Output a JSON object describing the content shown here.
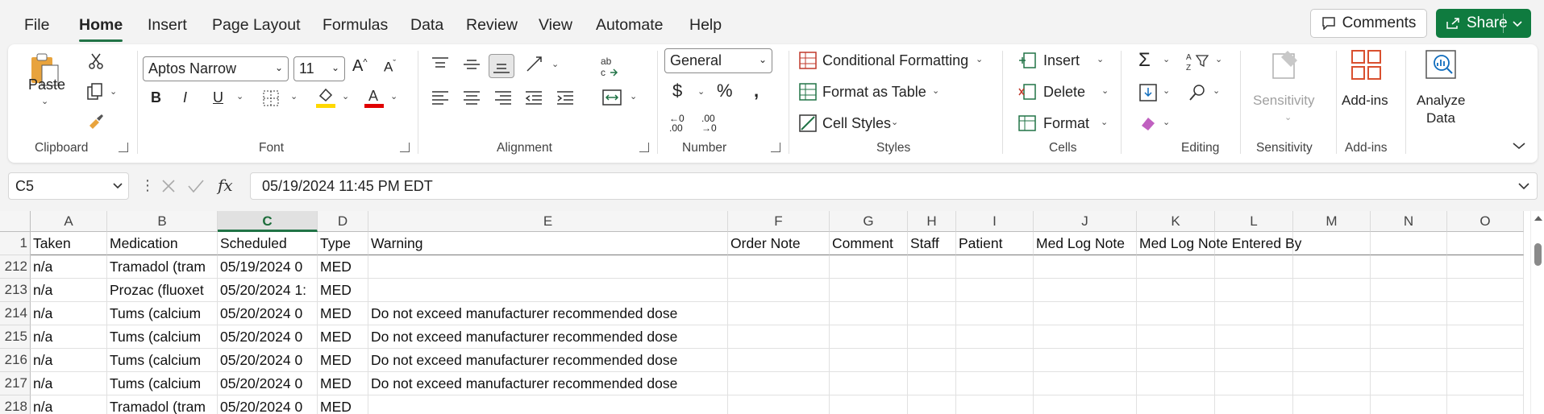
{
  "menu": {
    "tabs": [
      "File",
      "Home",
      "Insert",
      "Page Layout",
      "Formulas",
      "Data",
      "Review",
      "View",
      "Automate",
      "Help"
    ],
    "active_tab": "Home",
    "comments_label": "Comments",
    "share_label": "Share"
  },
  "ribbon": {
    "clipboard": {
      "paste_label": "Paste",
      "group_label": "Clipboard"
    },
    "font": {
      "font_name": "Aptos Narrow",
      "font_size": "11",
      "group_label": "Font",
      "fill_color": "#ffd800",
      "font_color": "#e00000"
    },
    "alignment": {
      "group_label": "Alignment"
    },
    "number": {
      "format": "General",
      "group_label": "Number"
    },
    "styles": {
      "conditional_formatting": "Conditional Formatting",
      "format_as_table": "Format as Table",
      "cell_styles": "Cell Styles",
      "group_label": "Styles"
    },
    "cells": {
      "insert": "Insert",
      "delete": "Delete",
      "format": "Format",
      "group_label": "Cells"
    },
    "editing": {
      "group_label": "Editing"
    },
    "sensitivity": {
      "label": "Sensitivity",
      "group_label": "Sensitivity"
    },
    "addins": {
      "label": "Add-ins",
      "group_label": "Add-ins"
    },
    "analyze": {
      "line1": "Analyze",
      "line2": "Data"
    }
  },
  "formula_bar": {
    "name_box": "C5",
    "formula": "05/19/2024 11:45 PM EDT"
  },
  "sheet": {
    "selected_column": "C",
    "columns": [
      "A",
      "B",
      "C",
      "D",
      "E",
      "F",
      "G",
      "H",
      "I",
      "J",
      "K",
      "L",
      "M",
      "N",
      "O"
    ],
    "header_row": {
      "row_number": "1",
      "cells": [
        "Taken",
        "Medication",
        "Scheduled",
        "Type",
        "Warning",
        "Order Note",
        "Comment",
        "Staff",
        "Patient",
        "Med Log Note",
        "Med Log Note Entered By",
        "",
        "",
        "",
        ""
      ]
    },
    "rows": [
      {
        "row_number": "212",
        "cells": [
          "n/a",
          "Tramadol (tram",
          "05/19/2024 0",
          "MED",
          "",
          "",
          "",
          "",
          "",
          "",
          "",
          "",
          "",
          "",
          ""
        ]
      },
      {
        "row_number": "213",
        "cells": [
          "n/a",
          "Prozac (fluoxet",
          "05/20/2024 1:",
          "MED",
          "",
          "",
          "",
          "",
          "",
          "",
          "",
          "",
          "",
          "",
          ""
        ]
      },
      {
        "row_number": "214",
        "cells": [
          "n/a",
          "Tums (calcium",
          "05/20/2024 0",
          "MED",
          "Do not exceed manufacturer recommended dose",
          "",
          "",
          "",
          "",
          "",
          "",
          "",
          "",
          "",
          ""
        ]
      },
      {
        "row_number": "215",
        "cells": [
          "n/a",
          "Tums (calcium",
          "05/20/2024 0",
          "MED",
          "Do not exceed manufacturer recommended dose",
          "",
          "",
          "",
          "",
          "",
          "",
          "",
          "",
          "",
          ""
        ]
      },
      {
        "row_number": "216",
        "cells": [
          "n/a",
          "Tums (calcium",
          "05/20/2024 0",
          "MED",
          "Do not exceed manufacturer recommended dose",
          "",
          "",
          "",
          "",
          "",
          "",
          "",
          "",
          "",
          ""
        ]
      },
      {
        "row_number": "217",
        "cells": [
          "n/a",
          "Tums (calcium",
          "05/20/2024 0",
          "MED",
          "Do not exceed manufacturer recommended dose",
          "",
          "",
          "",
          "",
          "",
          "",
          "",
          "",
          "",
          ""
        ]
      },
      {
        "row_number": "218",
        "cells": [
          "n/a",
          "Tramadol (tram",
          "05/20/2024 0",
          "MED",
          "",
          "",
          "",
          "",
          "",
          "",
          "",
          "",
          "",
          "",
          ""
        ]
      }
    ]
  },
  "colors": {
    "accent": "#217346",
    "share_bg": "#0f7b3f"
  }
}
